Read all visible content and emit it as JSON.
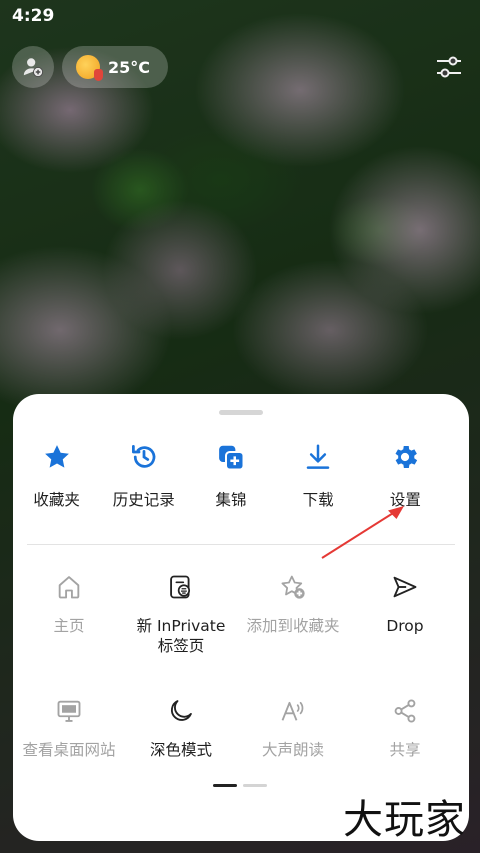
{
  "status_bar": {
    "time": "4:29"
  },
  "top_bar": {
    "profile_icon": "add-profile-icon",
    "weather": {
      "icon": "sun-icon",
      "temperature": "25°C"
    },
    "customize_icon": "tune-sliders-icon"
  },
  "menu": {
    "top_row": [
      {
        "label": "收藏夹",
        "icon": "star-icon"
      },
      {
        "label": "历史记录",
        "icon": "history-icon"
      },
      {
        "label": "集锦",
        "icon": "collections-icon"
      },
      {
        "label": "下载",
        "icon": "download-icon"
      },
      {
        "label": "设置",
        "icon": "gear-icon"
      }
    ],
    "middle_row": [
      {
        "label": "主页",
        "icon": "home-icon",
        "enabled": false
      },
      {
        "label": "新 InPrivate\n标签页",
        "icon": "inprivate-tab-icon",
        "enabled": true
      },
      {
        "label": "添加到收藏夹",
        "icon": "star-add-icon",
        "enabled": false
      },
      {
        "label": "Drop",
        "icon": "send-icon",
        "enabled": true
      }
    ],
    "bottom_row": [
      {
        "label": "查看桌面网站",
        "icon": "desktop-icon",
        "enabled": false
      },
      {
        "label": "深色模式",
        "icon": "moon-icon",
        "enabled": true
      },
      {
        "label": "大声朗读",
        "icon": "read-aloud-icon",
        "enabled": false
      },
      {
        "label": "共享",
        "icon": "share-icon",
        "enabled": false
      }
    ],
    "pager": {
      "pages": 2,
      "current": 1
    }
  },
  "colors": {
    "accent": "#1a73d9",
    "disabled": "#a3a3a3",
    "annotation_arrow": "#e53935"
  },
  "watermark": {
    "text": "大玩家"
  }
}
